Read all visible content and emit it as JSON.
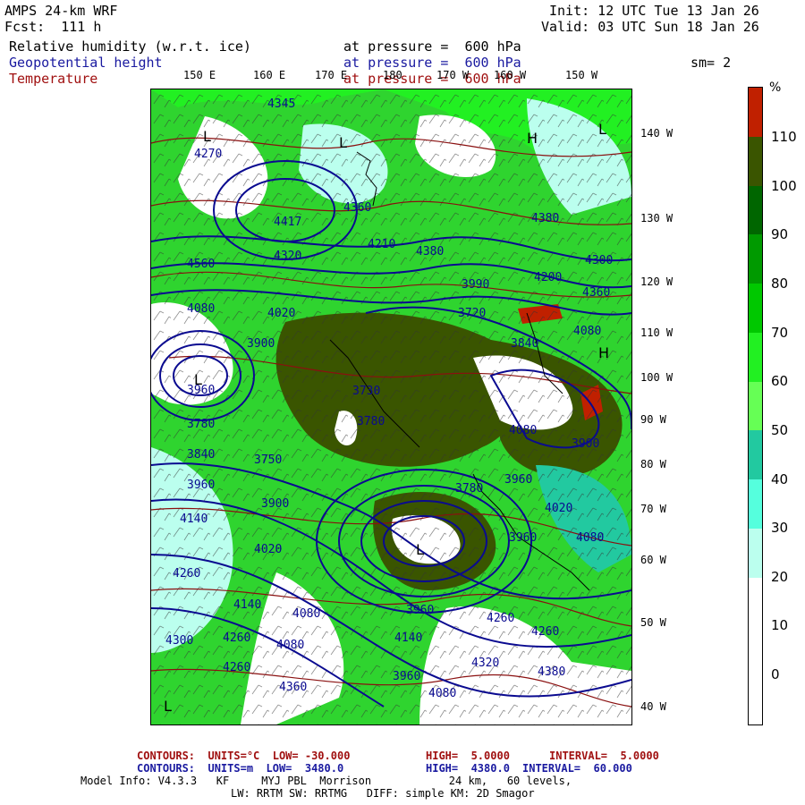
{
  "header": {
    "model": "AMPS 24-km WRF",
    "fcst": "Fcst:  111 h",
    "init": "Init: 12 UTC Tue 13 Jan 26",
    "valid": "Valid: 03 UTC Sun 18 Jan 26",
    "field1_name": "Relative humidity (w.r.t. ice)",
    "field1_level": "at pressure =  600 hPa",
    "field2_name": "Geopotential height",
    "field2_level": "at pressure =  600 hPa",
    "smoothing": "sm= 2",
    "field3_name": "Temperature",
    "field3_level": "at pressure =  600 hPa"
  },
  "map": {
    "top_lon_labels": [
      "150 E",
      "160 E",
      "170 E",
      "180",
      "170 W",
      "160 W",
      "150 W"
    ],
    "right_lon_labels": [
      "140 W",
      "130 W",
      "120 W",
      "110 W",
      "100 W",
      "90 W",
      "80 W",
      "70 W",
      "60 W",
      "50 W",
      "40 W"
    ],
    "height_labels": [
      "4345",
      "4270",
      "4417",
      "4320",
      "4210",
      "4380",
      "4360",
      "4380",
      "4200",
      "4360",
      "4300",
      "4560",
      "4080",
      "4020",
      "3900",
      "3720",
      "3840",
      "4080",
      "3990",
      "3960",
      "3780",
      "3730",
      "3780",
      "3900",
      "3750",
      "3840",
      "3960",
      "4020",
      "3960",
      "3780",
      "3960",
      "4140",
      "4020",
      "4080",
      "4260",
      "4140",
      "4080",
      "4260",
      "4300",
      "4260",
      "4360",
      "4080",
      "4320",
      "4380",
      "3960",
      "4140",
      "3960",
      "4080",
      "3900",
      "4080",
      "4260",
      "4260"
    ],
    "low_marks": [
      "L",
      "L",
      "L",
      "L",
      "L",
      "L"
    ],
    "high_marks": [
      "H",
      "H"
    ]
  },
  "colorbar": {
    "unit": "%",
    "ticks": [
      "110",
      "100",
      "90",
      "80",
      "70",
      "60",
      "50",
      "40",
      "30",
      "20",
      "10",
      "0"
    ],
    "colors": [
      "#c02000",
      "#3a5500",
      "#006600",
      "#009a00",
      "#00c800",
      "#22f022",
      "#66ff55",
      "#22c9a0",
      "#55ffdd",
      "#bbffee",
      "#ffffff",
      "#ffffff",
      "#ffffff"
    ]
  },
  "footer": {
    "line1_label": "CONTOURS:  UNITS=°C  LOW= -30.000",
    "line1_high": "HIGH=  5.0000",
    "line1_interval": "INTERVAL=  5.0000",
    "line2_label": "CONTOURS:  UNITS=m  LOW=  3480.0",
    "line2_high": "HIGH=  4380.0",
    "line2_interval": "INTERVAL=  60.000",
    "line3": "Model Info: V4.3.3   KF     MYJ PBL  Morrison            24 km,   60 levels,",
    "line4": "LW: RRTM SW: RRTMG   DIFF: simple KM: 2D Smagor"
  }
}
